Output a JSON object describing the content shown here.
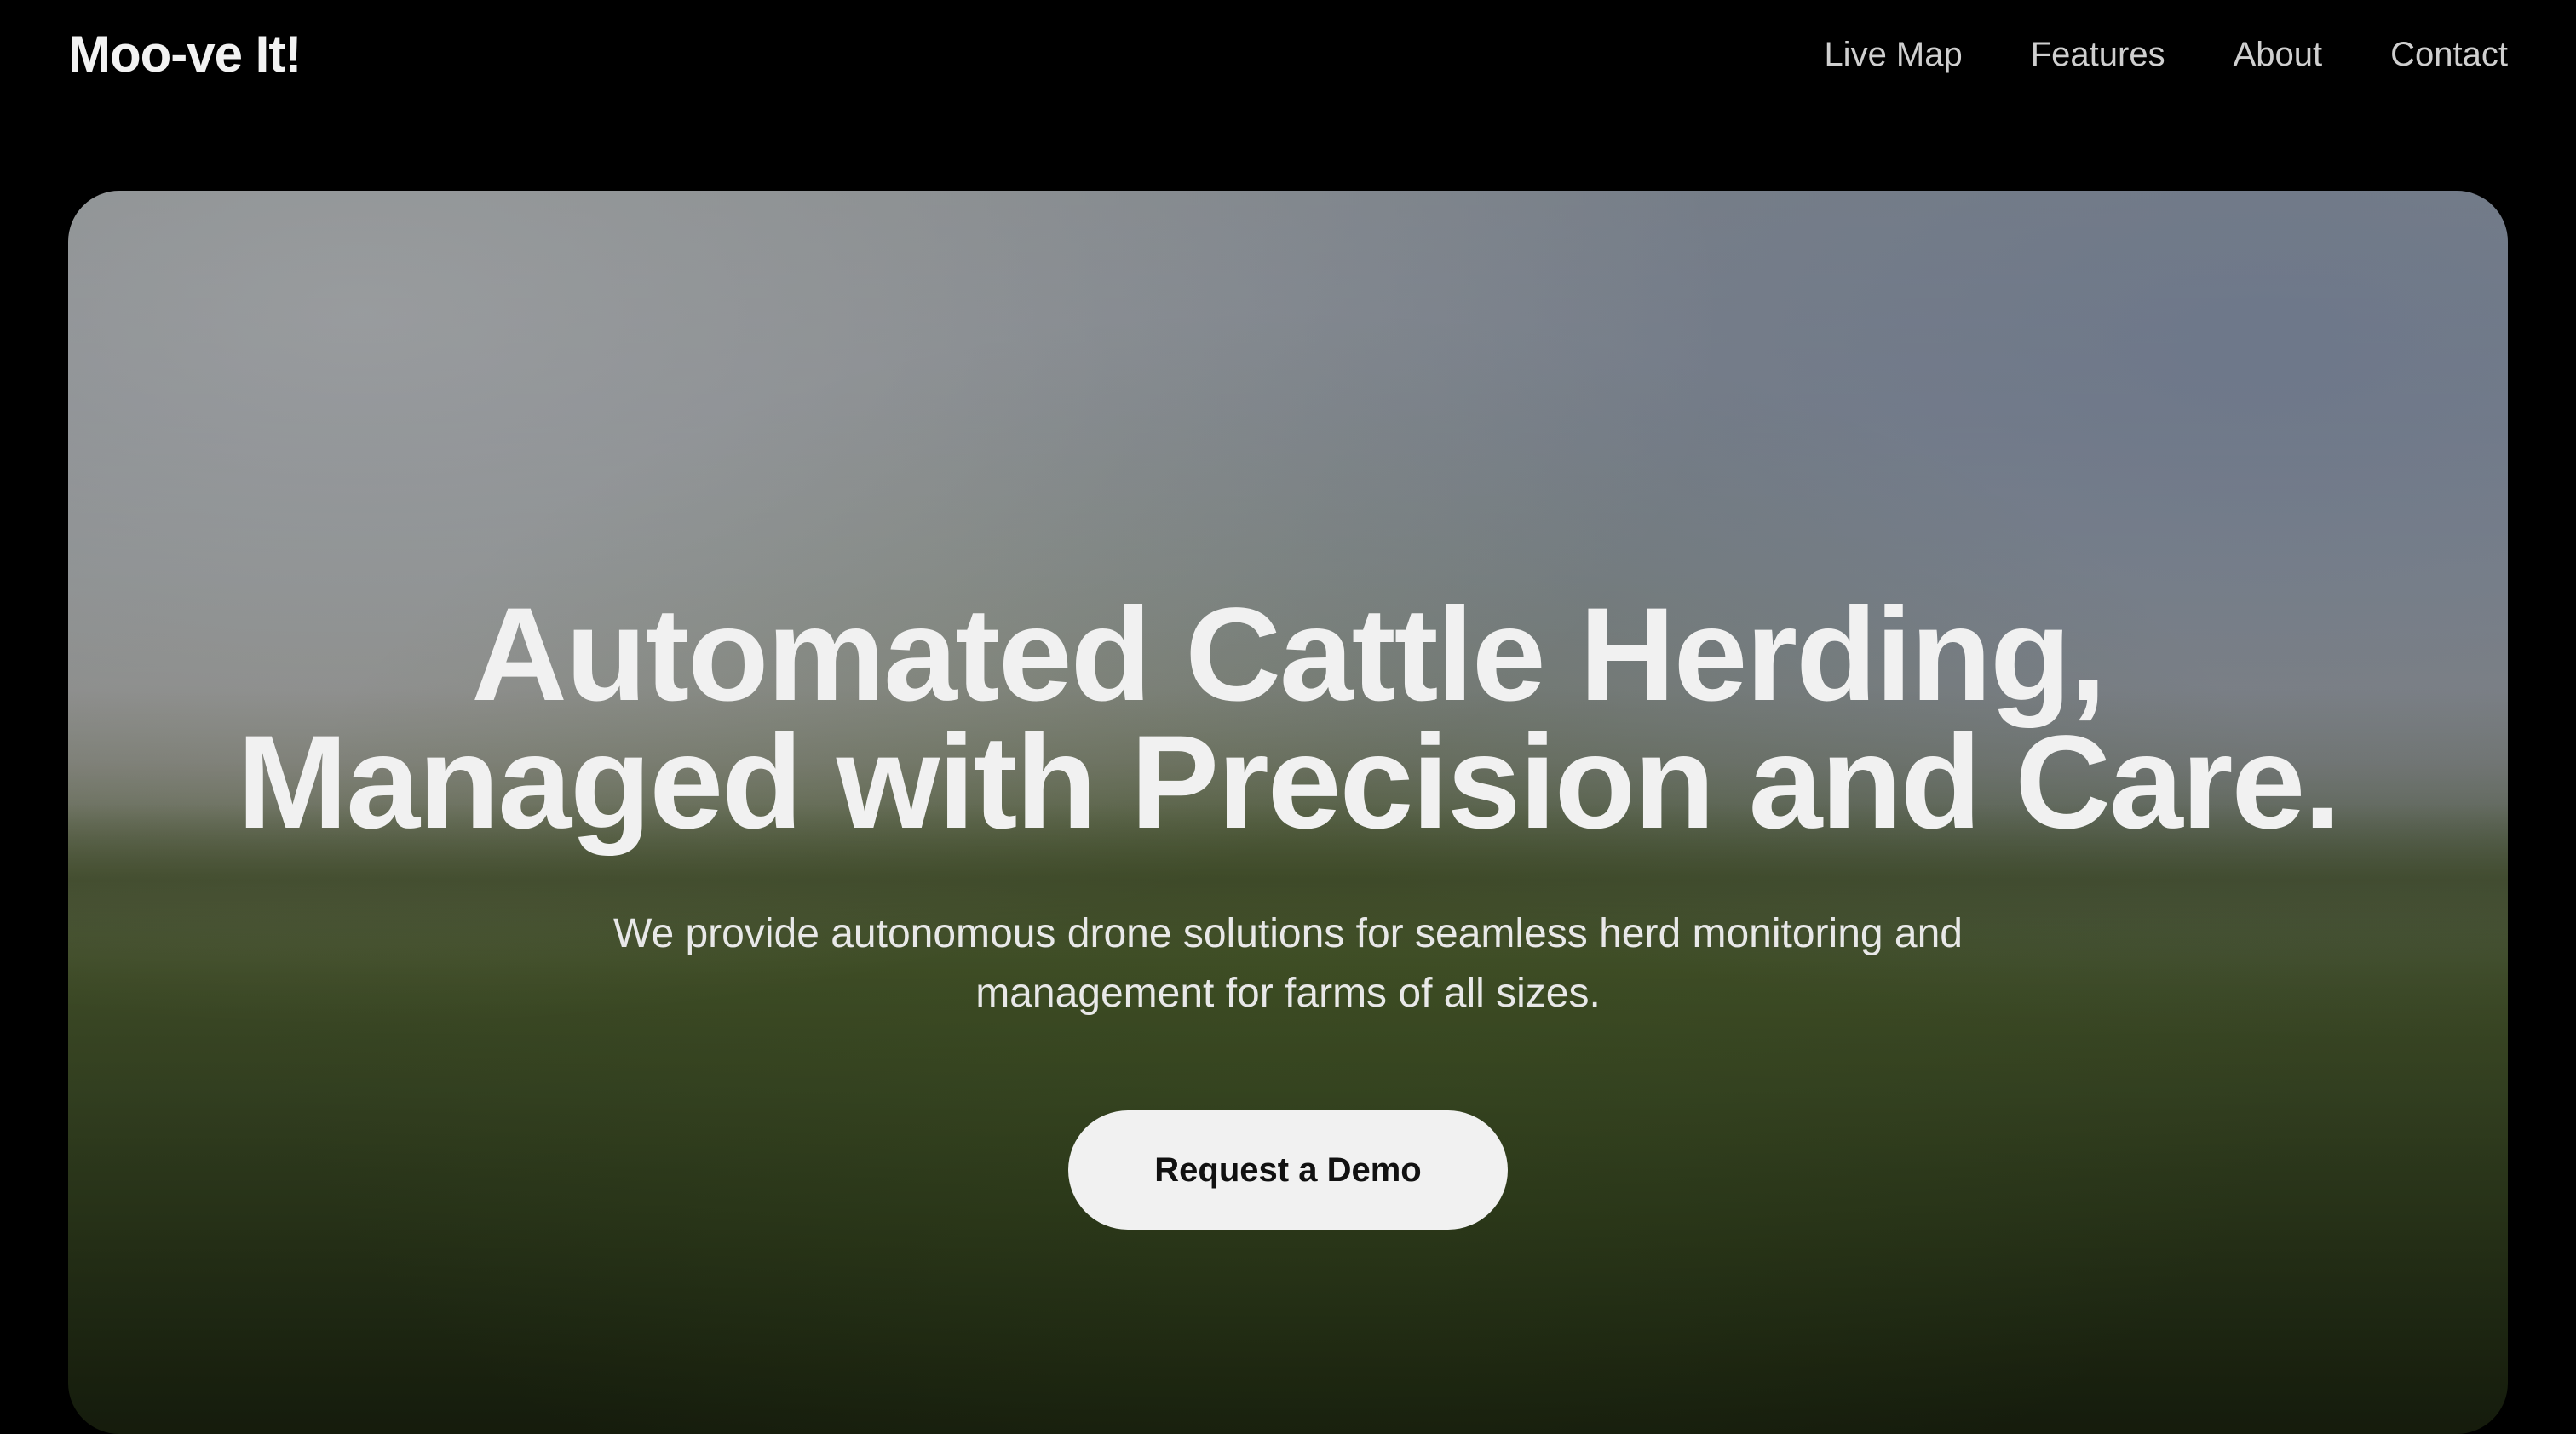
{
  "nav": {
    "brand": "Moo-ve It!",
    "links": [
      {
        "label": "Live Map"
      },
      {
        "label": "Features"
      },
      {
        "label": "About"
      },
      {
        "label": "Contact"
      }
    ]
  },
  "hero": {
    "headline_line1": "Automated Cattle Herding,",
    "headline_line2": "Managed with Precision and Care.",
    "subtext": "We provide autonomous drone solutions for seamless herd monitoring and management for farms of all sizes.",
    "cta_label": "Request a Demo"
  }
}
